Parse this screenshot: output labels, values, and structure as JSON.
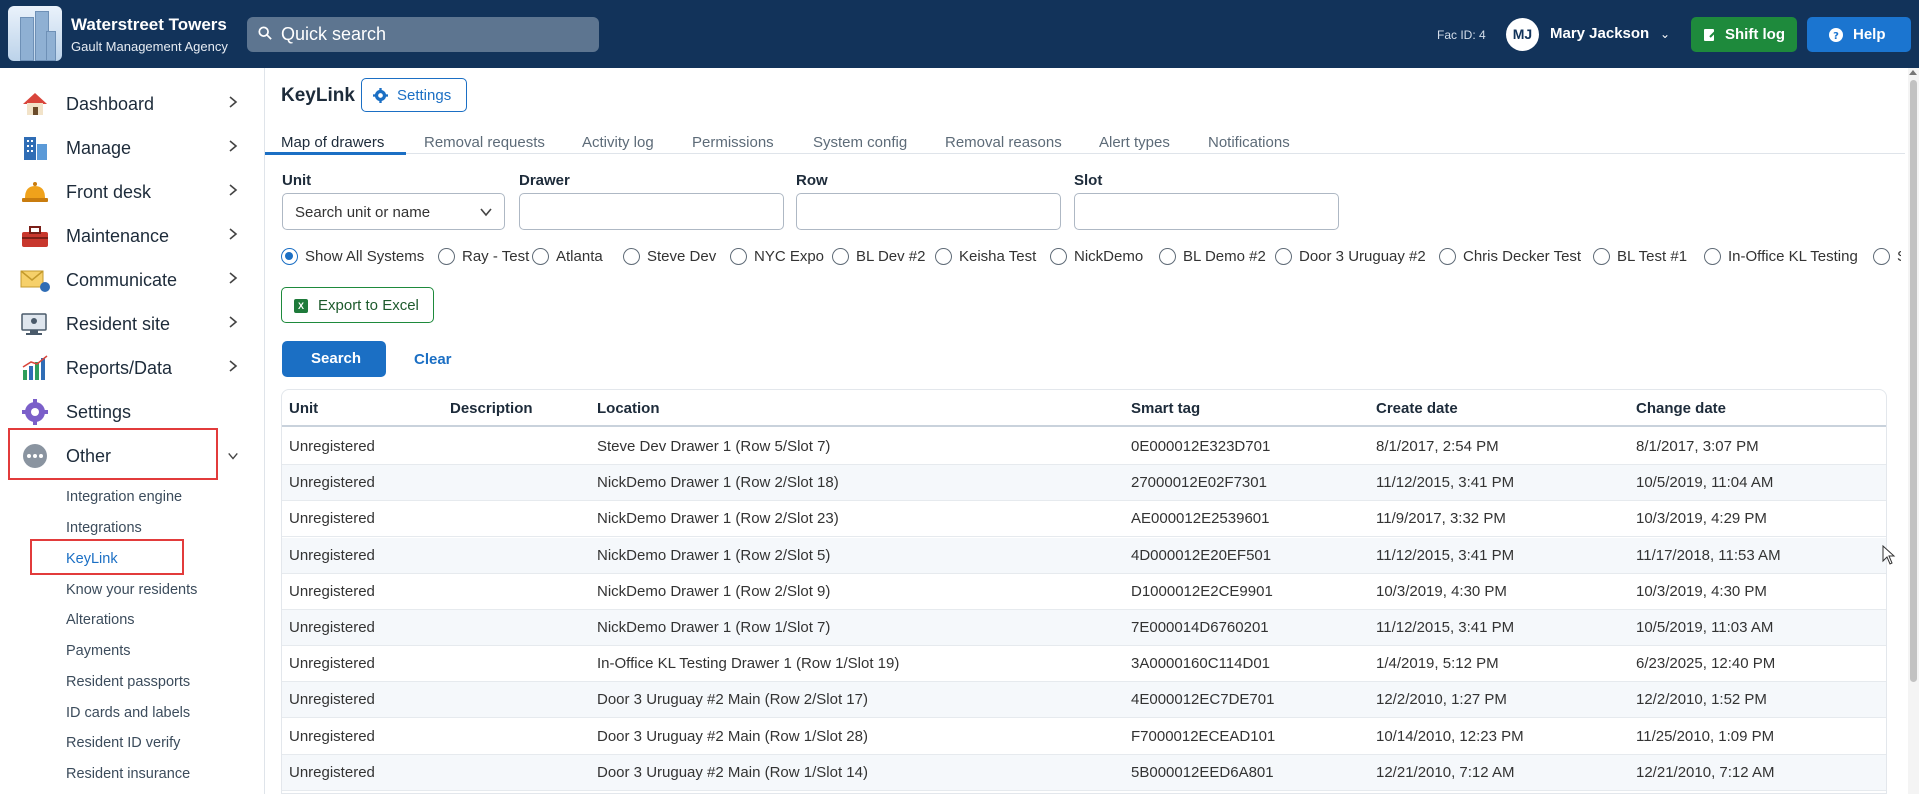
{
  "brand": {
    "name": "Waterstreet Towers",
    "subtitle": "Gault Management Agency"
  },
  "search": {
    "placeholder": "Quick search"
  },
  "header": {
    "fac_id": "Fac ID: 4",
    "user_initials": "MJ",
    "user_name": "Mary Jackson",
    "shift_log_label": "Shift log",
    "help_label": "Help"
  },
  "sidebar": {
    "items": [
      {
        "label": "Dashboard",
        "icon": "house-icon"
      },
      {
        "label": "Manage",
        "icon": "building-icon"
      },
      {
        "label": "Front desk",
        "icon": "bell-icon"
      },
      {
        "label": "Maintenance",
        "icon": "toolbox-icon"
      },
      {
        "label": "Communicate",
        "icon": "envelope-icon"
      },
      {
        "label": "Resident site",
        "icon": "monitor-icon"
      },
      {
        "label": "Reports/Data",
        "icon": "bar-chart-icon"
      },
      {
        "label": "Settings",
        "icon": "gear-icon"
      },
      {
        "label": "Other",
        "icon": "dots-icon"
      }
    ],
    "sub_items": [
      "Integration engine",
      "Integrations",
      "KeyLink",
      "Know your residents",
      "Alterations",
      "Payments",
      "Resident passports",
      "ID cards and labels",
      "Resident ID verify",
      "Resident insurance"
    ]
  },
  "page": {
    "title": "KeyLink",
    "settings_label": "Settings",
    "tabs": [
      "Map of drawers",
      "Removal requests",
      "Activity log",
      "Permissions",
      "System config",
      "Removal reasons",
      "Alert types",
      "Notifications"
    ]
  },
  "filters": {
    "unit_label": "Unit",
    "unit_placeholder": "Search unit or name",
    "drawer_label": "Drawer",
    "row_label": "Row",
    "slot_label": "Slot",
    "systems": [
      "Show All Systems",
      "Ray - Test",
      "Atlanta",
      "Steve Dev",
      "NYC Expo",
      "BL Dev #2",
      "Keisha Test",
      "NickDemo",
      "BL Demo #2",
      "Door 3 Uruguay #2",
      "Chris Decker Test",
      "BL Test #1",
      "In-Office KL Testing",
      "S"
    ],
    "selected_system": "Show All Systems"
  },
  "actions": {
    "export_label": "Export to Excel",
    "search_label": "Search",
    "clear_label": "Clear"
  },
  "table": {
    "columns": [
      "Unit",
      "Description",
      "Location",
      "Smart tag",
      "Create date",
      "Change date"
    ],
    "rows": [
      [
        "Unregistered",
        "",
        "Steve Dev Drawer 1 (Row 5/Slot 7)",
        "0E000012E323D701",
        "8/1/2017, 2:54 PM",
        "8/1/2017, 3:07 PM"
      ],
      [
        "Unregistered",
        "",
        "NickDemo Drawer 1 (Row 2/Slot 18)",
        "27000012E02F7301",
        "11/12/2015, 3:41 PM",
        "10/5/2019, 11:04 AM"
      ],
      [
        "Unregistered",
        "",
        "NickDemo Drawer 1 (Row 2/Slot 23)",
        "AE000012E2539601",
        "11/9/2017, 3:32 PM",
        "10/3/2019, 4:29 PM"
      ],
      [
        "Unregistered",
        "",
        "NickDemo Drawer 1 (Row 2/Slot 5)",
        "4D000012E20EF501",
        "11/12/2015, 3:41 PM",
        "11/17/2018, 11:53 AM"
      ],
      [
        "Unregistered",
        "",
        "NickDemo Drawer 1 (Row 2/Slot 9)",
        "D1000012E2CE9901",
        "10/3/2019, 4:30 PM",
        "10/3/2019, 4:30 PM"
      ],
      [
        "Unregistered",
        "",
        "NickDemo Drawer 1 (Row 1/Slot 7)",
        "7E000014D6760201",
        "11/12/2015, 3:41 PM",
        "10/5/2019, 11:03 AM"
      ],
      [
        "Unregistered",
        "",
        "In-Office KL Testing Drawer 1 (Row 1/Slot 19)",
        "3A0000160C114D01",
        "1/4/2019, 5:12 PM",
        "6/23/2025, 12:40 PM"
      ],
      [
        "Unregistered",
        "",
        "Door 3 Uruguay #2 Main (Row 2/Slot 17)",
        "4E000012EC7DE701",
        "12/2/2010, 1:27 PM",
        "12/2/2010, 1:52 PM"
      ],
      [
        "Unregistered",
        "",
        "Door 3 Uruguay #2 Main (Row 1/Slot 28)",
        "F7000012ECEAD101",
        "10/14/2010, 12:23 PM",
        "11/25/2010, 1:09 PM"
      ],
      [
        "Unregistered",
        "",
        "Door 3 Uruguay #2 Main (Row 1/Slot 14)",
        "5B000012EED6A801",
        "12/21/2010, 7:12 AM",
        "12/21/2010, 7:12 AM"
      ]
    ]
  },
  "colors": {
    "topbar": "#12335a",
    "accent": "#1b6fc4",
    "shift_log": "#1e8a3c",
    "highlight": "#e23b3b"
  }
}
